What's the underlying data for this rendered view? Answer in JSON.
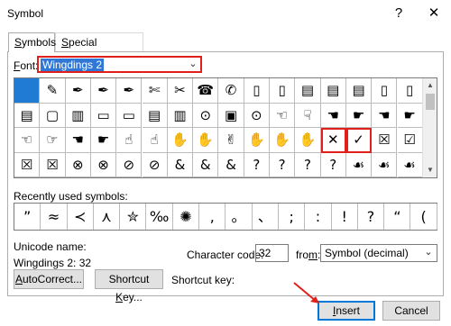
{
  "window": {
    "title": "Symbol",
    "help_icon": "?",
    "close_icon": "✕"
  },
  "tabs": [
    {
      "label_prefix": "",
      "label_u": "S",
      "label_rest": "ymbols",
      "active": true
    },
    {
      "label_prefix": "",
      "label_u": "S",
      "label_rest": "pecial Characters",
      "active": false
    }
  ],
  "font": {
    "label_u": "F",
    "label_rest": "ont:",
    "value": "Wingdings 2"
  },
  "symbol_grid": {
    "rows": [
      [
        "",
        "✎",
        "✒",
        "✒",
        "✒",
        "✄",
        "✂",
        "☎",
        "✆",
        "▯",
        "▯",
        "▤",
        "▤",
        "▤",
        "▯",
        "▯"
      ],
      [
        "▤",
        "▢",
        "▥",
        "▭",
        "▭",
        "▤",
        "▥",
        "⊙",
        "▣",
        "⊙",
        "☜",
        "☟",
        "☚",
        "☛",
        "☚",
        "☛"
      ],
      [
        "☜",
        "☞",
        "☚",
        "☛",
        "☝",
        "☝",
        "✋",
        "✋",
        "✌",
        "✋",
        "✋",
        "✋",
        "✕",
        "✓",
        "☒",
        "☑"
      ],
      [
        "☒",
        "☒",
        "⊗",
        "⊗",
        "⊘",
        "⊘",
        "&",
        "&",
        "&",
        "?",
        "?",
        "?",
        "?",
        "☙",
        "☙",
        "☙"
      ]
    ],
    "selected_index": 0,
    "highlighted_indices": [
      44,
      45
    ]
  },
  "recent": {
    "label_prefix": "Recently used symbols:",
    "symbols": [
      "”",
      "≈",
      "≺",
      "⋏",
      "✮",
      "‰",
      "✺",
      ",",
      "。",
      "、",
      ";",
      ":",
      "!",
      "?",
      "“",
      "("
    ]
  },
  "unicode": {
    "label": "Unicode name:",
    "value": "Wingdings 2: 32"
  },
  "character_code": {
    "label_prefix": "Character code:",
    "value": "32"
  },
  "from": {
    "label_u": "m",
    "label_prefix": "fro",
    "label_rest": ":",
    "value": "Symbol (decimal)"
  },
  "buttons": {
    "autocorrect": {
      "label_u": "A",
      "label_rest": "utoCorrect..."
    },
    "shortcut": {
      "label_prefix": "Shortcut ",
      "label_u": "K",
      "label_rest": "ey..."
    },
    "shortcut_key_label": "Shortcut key:",
    "insert": {
      "label_u": "I",
      "label_rest": "nsert"
    },
    "cancel": "Cancel"
  },
  "colors": {
    "accent": "#0078d7",
    "highlight": "#e0211b",
    "selection": "#1f7bd4"
  }
}
